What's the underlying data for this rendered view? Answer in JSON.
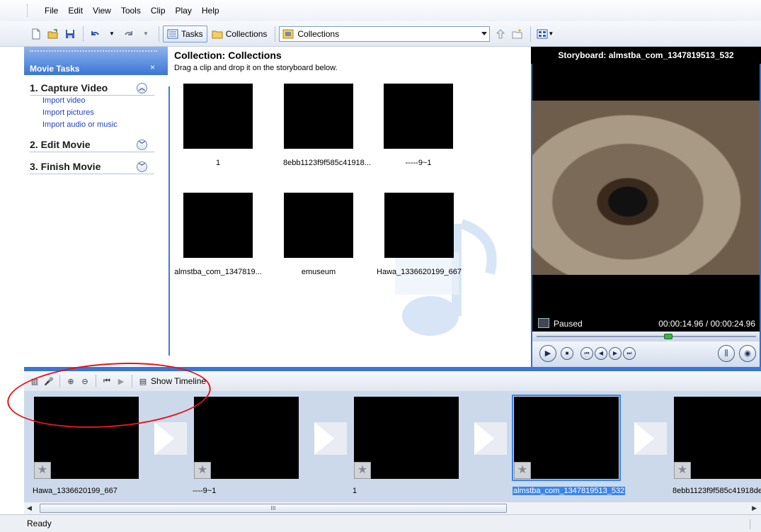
{
  "menu": [
    "File",
    "Edit",
    "View",
    "Tools",
    "Clip",
    "Play",
    "Help"
  ],
  "toolbar": {
    "tasks_label": "Tasks",
    "collections_label": "Collections",
    "combo_value": "Collections"
  },
  "tasks": {
    "header": "Movie Tasks",
    "close": "×",
    "sections": [
      {
        "title": "1. Capture Video",
        "chev": "︿",
        "links": [
          "Import video",
          "Import pictures",
          "Import audio or music"
        ]
      },
      {
        "title": "2. Edit Movie",
        "chev": "﹀"
      },
      {
        "title": "3. Finish Movie",
        "chev": "﹀"
      }
    ]
  },
  "collection": {
    "title": "Collection: Collections",
    "subtitle": "Drag a clip and drop it on the storyboard below.",
    "clips": [
      {
        "label": "1"
      },
      {
        "label": "8ebb1123f9f585c41918..."
      },
      {
        "label": "-----9~1"
      },
      {
        "label": "almstba_com_1347819..."
      },
      {
        "label": "emuseum"
      },
      {
        "label": "Hawa_1336620199_667"
      }
    ]
  },
  "monitor": {
    "title": "Storyboard: almstba_com_1347819513_532",
    "status": "Paused",
    "time": "00:00:14.96 / 00:00:24.96"
  },
  "storyboard_toolbar": {
    "show_timeline": "Show Timeline"
  },
  "storyboard": {
    "frames": [
      {
        "label": "Hawa_1336620199_667",
        "selected": false
      },
      {
        "label": "----9~1",
        "selected": false
      },
      {
        "label": "1",
        "selected": false
      },
      {
        "label": "almstba_com_1347819513_532",
        "selected": true
      },
      {
        "label": "8ebb1123f9f585c41918de",
        "selected": false
      }
    ]
  },
  "scrollbar": {
    "grip": "III"
  },
  "status": {
    "text": "Ready"
  },
  "colors": {
    "accent": "#3a76d3",
    "selection": "#3b86ea",
    "annotation": "#e3141b"
  }
}
